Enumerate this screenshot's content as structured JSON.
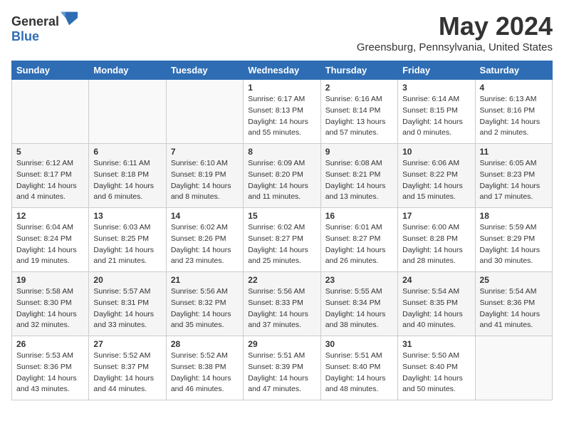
{
  "logo": {
    "general": "General",
    "blue": "Blue"
  },
  "title": "May 2024",
  "location": "Greensburg, Pennsylvania, United States",
  "headers": [
    "Sunday",
    "Monday",
    "Tuesday",
    "Wednesday",
    "Thursday",
    "Friday",
    "Saturday"
  ],
  "weeks": [
    [
      {
        "day": "",
        "sunrise": "",
        "sunset": "",
        "daylight": ""
      },
      {
        "day": "",
        "sunrise": "",
        "sunset": "",
        "daylight": ""
      },
      {
        "day": "",
        "sunrise": "",
        "sunset": "",
        "daylight": ""
      },
      {
        "day": "1",
        "sunrise": "Sunrise: 6:17 AM",
        "sunset": "Sunset: 8:13 PM",
        "daylight": "Daylight: 14 hours and 55 minutes."
      },
      {
        "day": "2",
        "sunrise": "Sunrise: 6:16 AM",
        "sunset": "Sunset: 8:14 PM",
        "daylight": "Daylight: 13 hours and 57 minutes."
      },
      {
        "day": "3",
        "sunrise": "Sunrise: 6:14 AM",
        "sunset": "Sunset: 8:15 PM",
        "daylight": "Daylight: 14 hours and 0 minutes."
      },
      {
        "day": "4",
        "sunrise": "Sunrise: 6:13 AM",
        "sunset": "Sunset: 8:16 PM",
        "daylight": "Daylight: 14 hours and 2 minutes."
      }
    ],
    [
      {
        "day": "5",
        "sunrise": "Sunrise: 6:12 AM",
        "sunset": "Sunset: 8:17 PM",
        "daylight": "Daylight: 14 hours and 4 minutes."
      },
      {
        "day": "6",
        "sunrise": "Sunrise: 6:11 AM",
        "sunset": "Sunset: 8:18 PM",
        "daylight": "Daylight: 14 hours and 6 minutes."
      },
      {
        "day": "7",
        "sunrise": "Sunrise: 6:10 AM",
        "sunset": "Sunset: 8:19 PM",
        "daylight": "Daylight: 14 hours and 8 minutes."
      },
      {
        "day": "8",
        "sunrise": "Sunrise: 6:09 AM",
        "sunset": "Sunset: 8:20 PM",
        "daylight": "Daylight: 14 hours and 11 minutes."
      },
      {
        "day": "9",
        "sunrise": "Sunrise: 6:08 AM",
        "sunset": "Sunset: 8:21 PM",
        "daylight": "Daylight: 14 hours and 13 minutes."
      },
      {
        "day": "10",
        "sunrise": "Sunrise: 6:06 AM",
        "sunset": "Sunset: 8:22 PM",
        "daylight": "Daylight: 14 hours and 15 minutes."
      },
      {
        "day": "11",
        "sunrise": "Sunrise: 6:05 AM",
        "sunset": "Sunset: 8:23 PM",
        "daylight": "Daylight: 14 hours and 17 minutes."
      }
    ],
    [
      {
        "day": "12",
        "sunrise": "Sunrise: 6:04 AM",
        "sunset": "Sunset: 8:24 PM",
        "daylight": "Daylight: 14 hours and 19 minutes."
      },
      {
        "day": "13",
        "sunrise": "Sunrise: 6:03 AM",
        "sunset": "Sunset: 8:25 PM",
        "daylight": "Daylight: 14 hours and 21 minutes."
      },
      {
        "day": "14",
        "sunrise": "Sunrise: 6:02 AM",
        "sunset": "Sunset: 8:26 PM",
        "daylight": "Daylight: 14 hours and 23 minutes."
      },
      {
        "day": "15",
        "sunrise": "Sunrise: 6:02 AM",
        "sunset": "Sunset: 8:27 PM",
        "daylight": "Daylight: 14 hours and 25 minutes."
      },
      {
        "day": "16",
        "sunrise": "Sunrise: 6:01 AM",
        "sunset": "Sunset: 8:27 PM",
        "daylight": "Daylight: 14 hours and 26 minutes."
      },
      {
        "day": "17",
        "sunrise": "Sunrise: 6:00 AM",
        "sunset": "Sunset: 8:28 PM",
        "daylight": "Daylight: 14 hours and 28 minutes."
      },
      {
        "day": "18",
        "sunrise": "Sunrise: 5:59 AM",
        "sunset": "Sunset: 8:29 PM",
        "daylight": "Daylight: 14 hours and 30 minutes."
      }
    ],
    [
      {
        "day": "19",
        "sunrise": "Sunrise: 5:58 AM",
        "sunset": "Sunset: 8:30 PM",
        "daylight": "Daylight: 14 hours and 32 minutes."
      },
      {
        "day": "20",
        "sunrise": "Sunrise: 5:57 AM",
        "sunset": "Sunset: 8:31 PM",
        "daylight": "Daylight: 14 hours and 33 minutes."
      },
      {
        "day": "21",
        "sunrise": "Sunrise: 5:56 AM",
        "sunset": "Sunset: 8:32 PM",
        "daylight": "Daylight: 14 hours and 35 minutes."
      },
      {
        "day": "22",
        "sunrise": "Sunrise: 5:56 AM",
        "sunset": "Sunset: 8:33 PM",
        "daylight": "Daylight: 14 hours and 37 minutes."
      },
      {
        "day": "23",
        "sunrise": "Sunrise: 5:55 AM",
        "sunset": "Sunset: 8:34 PM",
        "daylight": "Daylight: 14 hours and 38 minutes."
      },
      {
        "day": "24",
        "sunrise": "Sunrise: 5:54 AM",
        "sunset": "Sunset: 8:35 PM",
        "daylight": "Daylight: 14 hours and 40 minutes."
      },
      {
        "day": "25",
        "sunrise": "Sunrise: 5:54 AM",
        "sunset": "Sunset: 8:36 PM",
        "daylight": "Daylight: 14 hours and 41 minutes."
      }
    ],
    [
      {
        "day": "26",
        "sunrise": "Sunrise: 5:53 AM",
        "sunset": "Sunset: 8:36 PM",
        "daylight": "Daylight: 14 hours and 43 minutes."
      },
      {
        "day": "27",
        "sunrise": "Sunrise: 5:52 AM",
        "sunset": "Sunset: 8:37 PM",
        "daylight": "Daylight: 14 hours and 44 minutes."
      },
      {
        "day": "28",
        "sunrise": "Sunrise: 5:52 AM",
        "sunset": "Sunset: 8:38 PM",
        "daylight": "Daylight: 14 hours and 46 minutes."
      },
      {
        "day": "29",
        "sunrise": "Sunrise: 5:51 AM",
        "sunset": "Sunset: 8:39 PM",
        "daylight": "Daylight: 14 hours and 47 minutes."
      },
      {
        "day": "30",
        "sunrise": "Sunrise: 5:51 AM",
        "sunset": "Sunset: 8:40 PM",
        "daylight": "Daylight: 14 hours and 48 minutes."
      },
      {
        "day": "31",
        "sunrise": "Sunrise: 5:50 AM",
        "sunset": "Sunset: 8:40 PM",
        "daylight": "Daylight: 14 hours and 50 minutes."
      },
      {
        "day": "",
        "sunrise": "",
        "sunset": "",
        "daylight": ""
      }
    ]
  ]
}
